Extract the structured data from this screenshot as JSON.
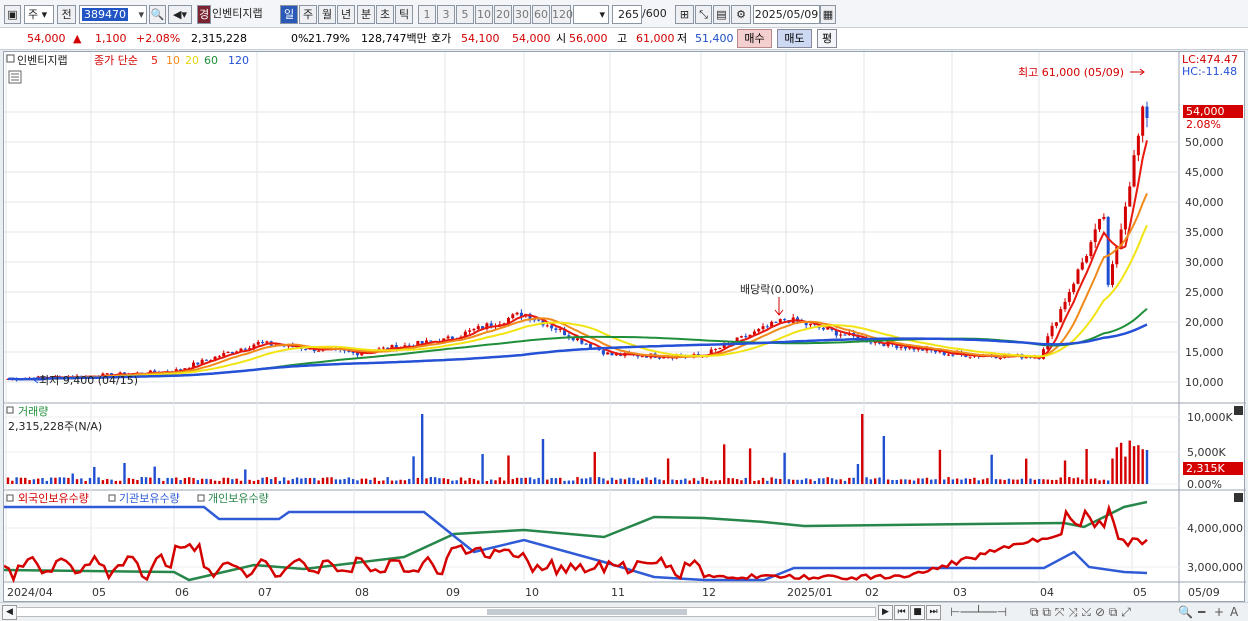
{
  "toolbar": {
    "period_sel": "주",
    "prev_label": "전",
    "stock_code": "389470",
    "stock_name": "인벤티지랩",
    "warn_badge": "경",
    "period_tabs": [
      "일",
      "주",
      "월",
      "년",
      "분",
      "초",
      "틱"
    ],
    "active_period": "일",
    "intervals": [
      "1",
      "3",
      "5",
      "10",
      "20",
      "30",
      "60",
      "120"
    ],
    "count_value": "265",
    "count_total": "/600",
    "date_value": "2025/05/09"
  },
  "quote": {
    "price": "54,000",
    "change_arrow": "▲",
    "change": "1,100",
    "change_pct": "+2.08%",
    "volume": "2,315,228",
    "ratio1": "0%",
    "ratio2": "21.79%",
    "amount": "128,747백만",
    "ask_label": "호가",
    "ask1": "54,100",
    "ask2": "54,000",
    "open_label": "시",
    "open": "56,000",
    "high_label": "고",
    "high": "61,000",
    "low_label": "저",
    "low": "51,400",
    "buy_label": "매수",
    "sell_label": "매도",
    "pyeong_label": "평"
  },
  "price_panel": {
    "stock_name": "인벤티지랩",
    "ma_caption": "종가 단순",
    "ma_periods": [
      "5",
      "10",
      "20",
      "60",
      "120"
    ],
    "ma_colors": [
      "#e8190f",
      "#f08a1b",
      "#f2e412",
      "#1f8f3a",
      "#2451d6"
    ],
    "lc_label": "LC:474.47",
    "hc_label": "HC:-11.48",
    "max_annotation": "최고 61,000 (05/09)",
    "min_annotation": "최저 9,400 (04/15)",
    "dividend_annotation": "배당락(0.00%)",
    "current_price_tag": "54,000",
    "current_pct_tag": "2.08%",
    "y_ticks": [
      "55,000",
      "50,000",
      "45,000",
      "40,000",
      "35,000",
      "30,000",
      "25,000",
      "20,000",
      "15,000",
      "10,000"
    ]
  },
  "volume_panel": {
    "title": "거래량",
    "subtitle": "2,315,228주(N/A)",
    "y_ticks": [
      "10,000K",
      "5,000K",
      "0.00%"
    ],
    "current_tag": "2,315K"
  },
  "holding_panel": {
    "legend": [
      "외국인보유수량",
      "기관보유수량",
      "개인보유수량"
    ],
    "legend_colors": [
      "#d40000",
      "#2f5bd6",
      "#27864a"
    ],
    "y_ticks": [
      "4,000,000",
      "3,000,000"
    ]
  },
  "x_axis": {
    "labels": [
      "2024/04",
      "05",
      "06",
      "07",
      "08",
      "09",
      "10",
      "11",
      "12",
      "2025/01",
      "02",
      "03",
      "04",
      "05",
      "05/09"
    ]
  },
  "chart_data": {
    "type": "candlestick",
    "title": "인벤티지랩",
    "x": [
      "2024/04",
      "05",
      "06",
      "07",
      "08",
      "09",
      "10",
      "11",
      "12",
      "2025/01",
      "02",
      "03",
      "04",
      "05"
    ],
    "series": [
      {
        "name": "5",
        "values": [
          10500,
          11000,
          11800,
          16500,
          14800,
          17000,
          21500,
          14500,
          14300,
          20500,
          17000,
          14600,
          14200,
          48000
        ]
      },
      {
        "name": "120",
        "values": [
          14000,
          13200,
          12200,
          12500,
          13500,
          14800,
          15800,
          16300,
          16800,
          17000,
          17200,
          17000,
          16500,
          18000
        ]
      }
    ],
    "ylim": [
      8000,
      63000
    ],
    "max_price": 61000,
    "min_price": 9400,
    "last_price": 54000
  }
}
